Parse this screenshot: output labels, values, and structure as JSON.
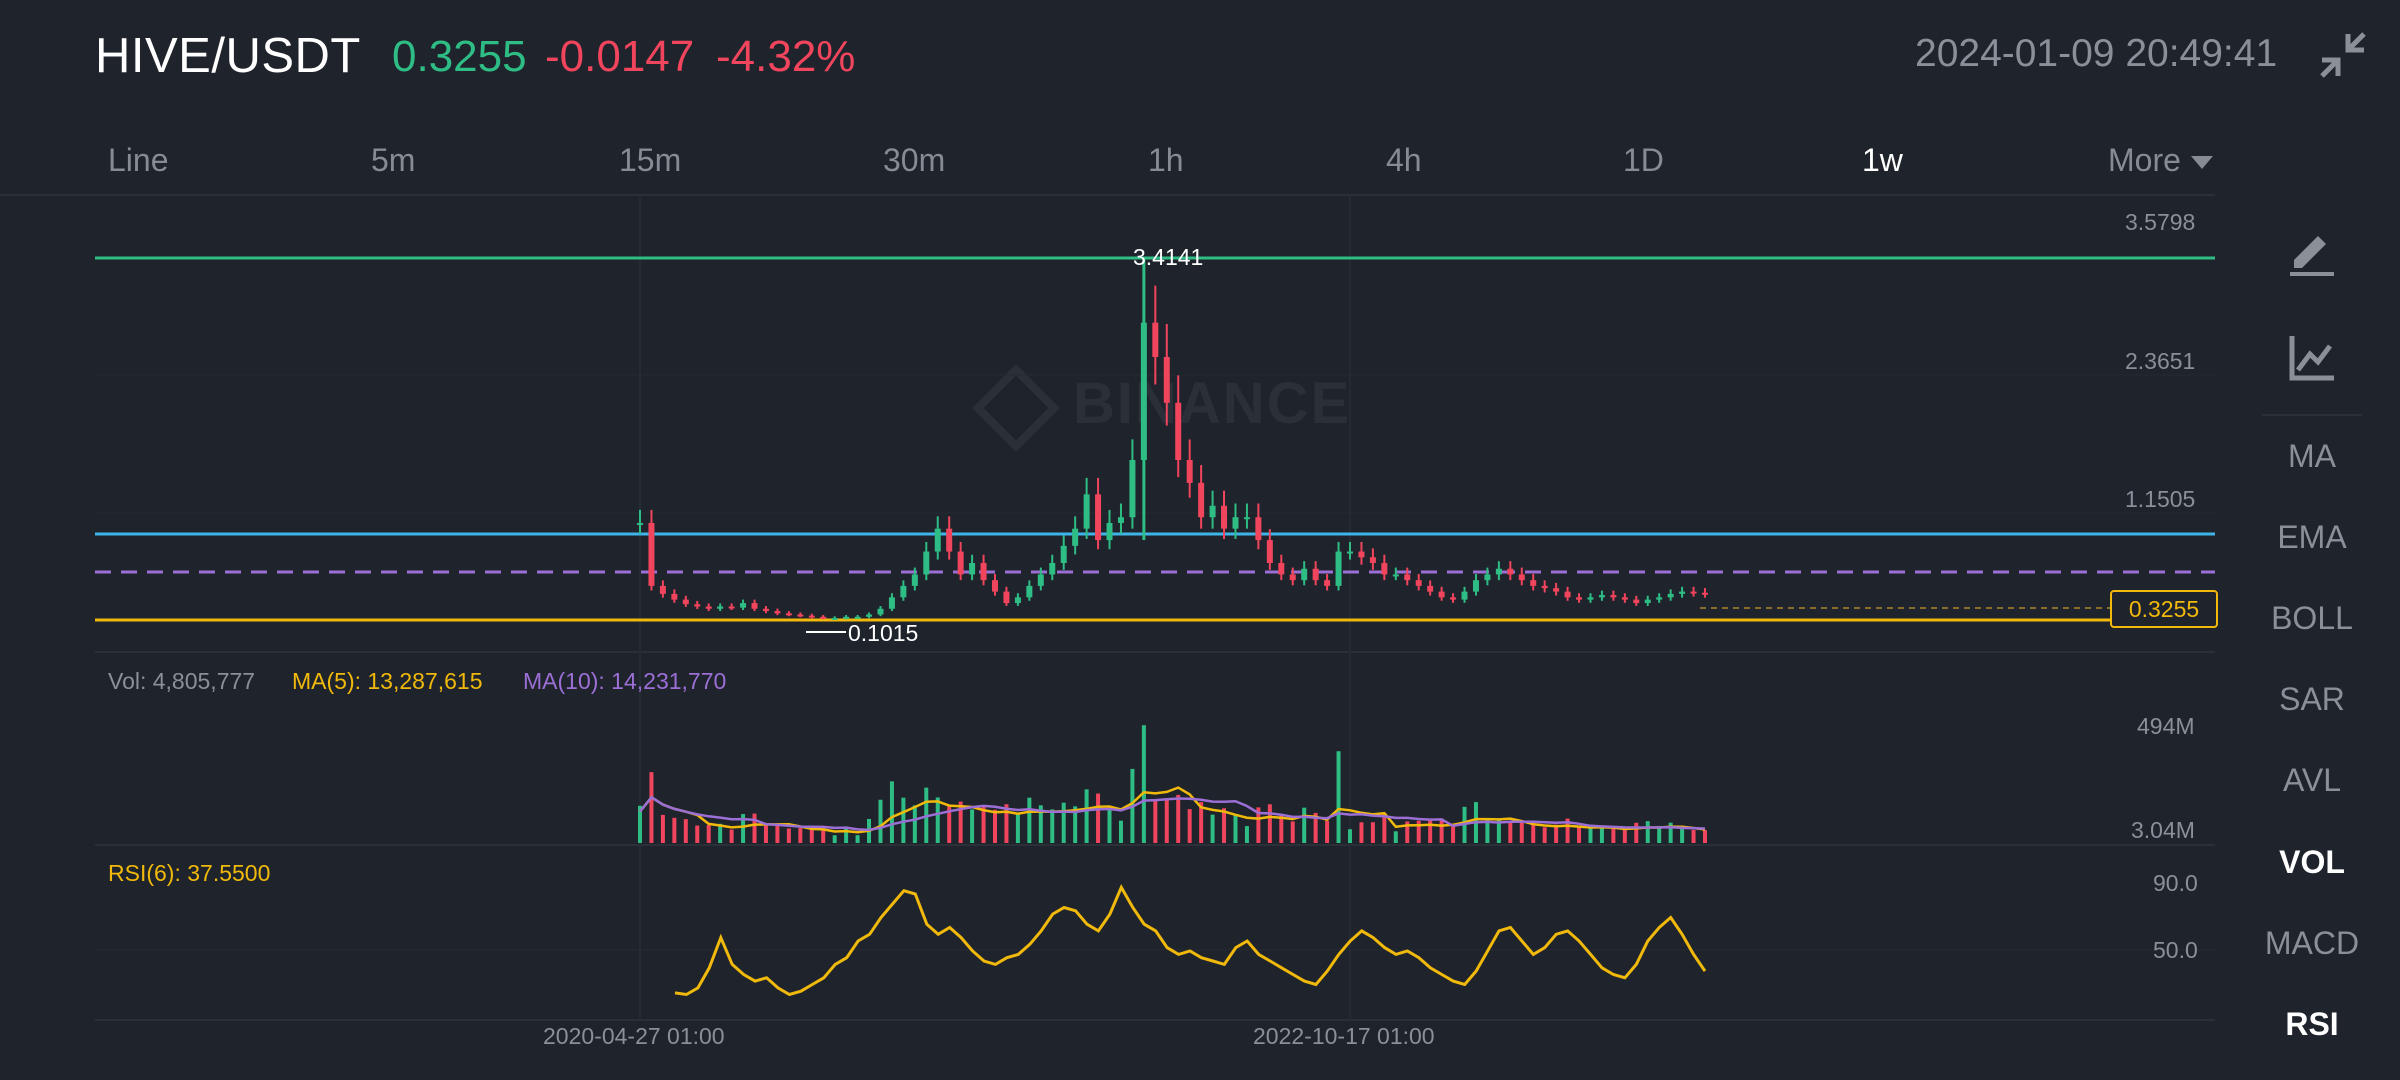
{
  "header": {
    "pair": "HIVE/USDT",
    "price": "0.3255",
    "change": "-0.0147",
    "change_pct": "-4.32%",
    "datetime": "2024-01-09 20:49:41",
    "collapse_icon": "collapse-icon"
  },
  "intervals": [
    "Line",
    "5m",
    "15m",
    "30m",
    "1h",
    "4h",
    "1D",
    "1w",
    "More"
  ],
  "active_interval": "1w",
  "sidebar": {
    "tools": [
      "draw-pen-icon",
      "chart-indicator-icon"
    ],
    "indicators": [
      "MA",
      "EMA",
      "BOLL",
      "SAR",
      "AVL",
      "VOL",
      "MACD",
      "RSI"
    ],
    "active": [
      "VOL",
      "RSI"
    ]
  },
  "watermark": "BINANCE",
  "price_axis": [
    "3.5798",
    "2.3651",
    "1.1505"
  ],
  "current_price_tag": "0.3255",
  "high_label": "3.4141",
  "low_label": "0.1015",
  "volume_pane": {
    "vol": "Vol: 4,805,777",
    "ma5": "MA(5): 13,287,615",
    "ma10": "MA(10): 14,231,770",
    "axis": [
      "494M",
      "3.04M"
    ]
  },
  "rsi_pane": {
    "label": "RSI(6): 37.5500",
    "axis": [
      "90.0",
      "50.0"
    ]
  },
  "time_axis": [
    "2020-04-27 01:00",
    "2022-10-17 01:00"
  ],
  "colors": {
    "up": "#2ebd85",
    "down": "#f0455d",
    "yellow": "#f0b90b",
    "purple": "#9b6fd6",
    "blue": "#3db5e8",
    "bg": "#1f232b"
  },
  "chart_data": {
    "type": "candlestick",
    "interval": "1w",
    "price_axis_ticks": [
      3.5798,
      2.3651,
      1.1505
    ],
    "high": 3.4141,
    "low": 0.1015,
    "last": 0.3255,
    "close_series": [
      0.95,
      0.4,
      0.33,
      0.28,
      0.24,
      0.22,
      0.2,
      0.22,
      0.21,
      0.25,
      0.2,
      0.18,
      0.16,
      0.15,
      0.14,
      0.13,
      0.12,
      0.12,
      0.13,
      0.13,
      0.15,
      0.2,
      0.3,
      0.4,
      0.5,
      0.7,
      0.9,
      0.7,
      0.5,
      0.6,
      0.45,
      0.35,
      0.25,
      0.3,
      0.4,
      0.5,
      0.6,
      0.75,
      0.9,
      1.2,
      0.8,
      0.95,
      1.0,
      1.5,
      2.7,
      2.4,
      2.0,
      1.5,
      1.3,
      1.0,
      1.1,
      0.9,
      1.0,
      1.0,
      0.8,
      0.6,
      0.5,
      0.45,
      0.55,
      0.45,
      0.4,
      0.7,
      0.7,
      0.65,
      0.6,
      0.5,
      0.5,
      0.45,
      0.4,
      0.35,
      0.3,
      0.28,
      0.35,
      0.45,
      0.5,
      0.55,
      0.5,
      0.45,
      0.4,
      0.38,
      0.35,
      0.3,
      0.28,
      0.3,
      0.32,
      0.3,
      0.28,
      0.25,
      0.28,
      0.3,
      0.33,
      0.35,
      0.34,
      0.33
    ],
    "volume_axis": [
      "494M",
      "3.04M"
    ],
    "rsi_axis": [
      90.0,
      50.0
    ],
    "rsi_last": 37.55,
    "rsi_series": [
      25,
      24,
      28,
      40,
      58,
      42,
      36,
      32,
      34,
      28,
      24,
      26,
      30,
      34,
      42,
      46,
      56,
      60,
      70,
      78,
      86,
      84,
      66,
      60,
      64,
      58,
      50,
      44,
      42,
      46,
      48,
      54,
      62,
      72,
      76,
      74,
      66,
      62,
      72,
      88,
      76,
      66,
      62,
      52,
      48,
      50,
      46,
      44,
      42,
      52,
      56,
      48,
      44,
      40,
      36,
      32,
      30,
      38,
      48,
      56,
      62,
      58,
      52,
      48,
      50,
      46,
      40,
      36,
      32,
      30,
      38,
      50,
      62,
      64,
      56,
      48,
      52,
      60,
      62,
      56,
      48,
      40,
      36,
      34,
      42,
      56,
      64,
      70,
      60,
      48,
      38
    ]
  }
}
